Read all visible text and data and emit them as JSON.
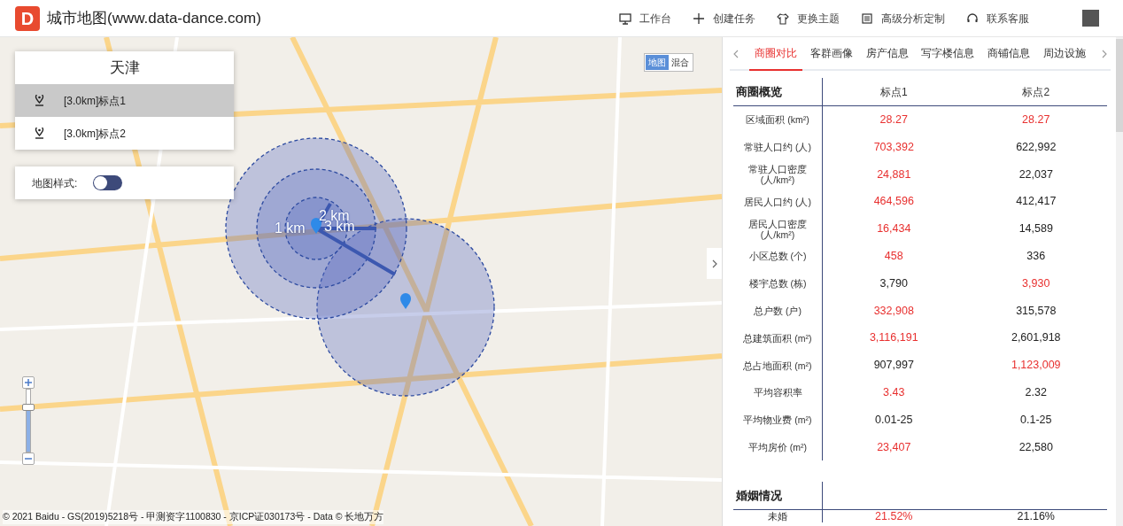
{
  "header": {
    "logo_letter": "D",
    "title": "城市地图(www.data-dance.com)",
    "nav": [
      {
        "label": "工作台"
      },
      {
        "label": "创建任务"
      },
      {
        "label": "更换主题"
      },
      {
        "label": "高级分析定制"
      },
      {
        "label": "联系客服"
      }
    ]
  },
  "map": {
    "city_card": {
      "title": "天津",
      "points": [
        {
          "label": "[3.0km]标点1",
          "selected": true
        },
        {
          "label": "[3.0km]标点2",
          "selected": false
        }
      ]
    },
    "style_card": {
      "label": "地图样式:",
      "on": false
    },
    "map_types": [
      {
        "label": "地图",
        "selected": true
      },
      {
        "label": "混合",
        "selected": false
      }
    ],
    "radius_labels": [
      "1 km",
      "2 km",
      "3 km"
    ],
    "zoom": {
      "level": 0.72
    },
    "copyright": "© 2021 Baidu - GS(2019)5218号 - 甲测资字1100830 - 京ICP证030173号 - Data © 长地万方"
  },
  "panel": {
    "tabs": [
      {
        "label": "商圈对比",
        "selected": true
      },
      {
        "label": "客群画像",
        "selected": false
      },
      {
        "label": "房产信息",
        "selected": false
      },
      {
        "label": "写字楼信息",
        "selected": false
      },
      {
        "label": "商铺信息",
        "selected": false
      },
      {
        "label": "周边设施",
        "selected": false
      }
    ],
    "sections": [
      {
        "title": "商圈概览",
        "columns": [
          "标点1",
          "标点2"
        ],
        "rows": [
          {
            "label": "区域面积 (km²)",
            "values": [
              {
                "text": "28.27",
                "highlight": true
              },
              {
                "text": "28.27",
                "highlight": true
              }
            ]
          },
          {
            "label": "常驻人口约 (人)",
            "values": [
              {
                "text": "703,392",
                "highlight": true
              },
              {
                "text": "622,992",
                "highlight": false
              }
            ]
          },
          {
            "label": "常驻人口密度 (人/km²)",
            "values": [
              {
                "text": "24,881",
                "highlight": true
              },
              {
                "text": "22,037",
                "highlight": false
              }
            ]
          },
          {
            "label": "居民人口约 (人)",
            "values": [
              {
                "text": "464,596",
                "highlight": true
              },
              {
                "text": "412,417",
                "highlight": false
              }
            ]
          },
          {
            "label": "居民人口密度 (人/km²)",
            "values": [
              {
                "text": "16,434",
                "highlight": true
              },
              {
                "text": "14,589",
                "highlight": false
              }
            ]
          },
          {
            "label": "小区总数 (个)",
            "values": [
              {
                "text": "458",
                "highlight": true
              },
              {
                "text": "336",
                "highlight": false
              }
            ]
          },
          {
            "label": "楼宇总数 (栋)",
            "values": [
              {
                "text": "3,790",
                "highlight": false
              },
              {
                "text": "3,930",
                "highlight": true
              }
            ]
          },
          {
            "label": "总户数 (户)",
            "values": [
              {
                "text": "332,908",
                "highlight": true
              },
              {
                "text": "315,578",
                "highlight": false
              }
            ]
          },
          {
            "label": "总建筑面积 (m²)",
            "values": [
              {
                "text": "3,116,191",
                "highlight": true
              },
              {
                "text": "2,601,918",
                "highlight": false
              }
            ]
          },
          {
            "label": "总占地面积 (m²)",
            "values": [
              {
                "text": "907,997",
                "highlight": false
              },
              {
                "text": "1,123,009",
                "highlight": true
              }
            ]
          },
          {
            "label": "平均容积率",
            "values": [
              {
                "text": "3.43",
                "highlight": true
              },
              {
                "text": "2.32",
                "highlight": false
              }
            ]
          },
          {
            "label": "平均物业费 (m²)",
            "values": [
              {
                "text": "0.01-25",
                "highlight": false
              },
              {
                "text": "0.1-25",
                "highlight": false
              }
            ]
          },
          {
            "label": "平均房价 (m²)",
            "values": [
              {
                "text": "23,407",
                "highlight": true
              },
              {
                "text": "22,580",
                "highlight": false
              }
            ]
          }
        ]
      },
      {
        "title": "婚姻情况",
        "rows": [
          {
            "label": "未婚",
            "values": [
              {
                "text": "21.52%",
                "highlight": true
              },
              {
                "text": "21.16%",
                "highlight": false
              }
            ]
          }
        ]
      }
    ]
  }
}
